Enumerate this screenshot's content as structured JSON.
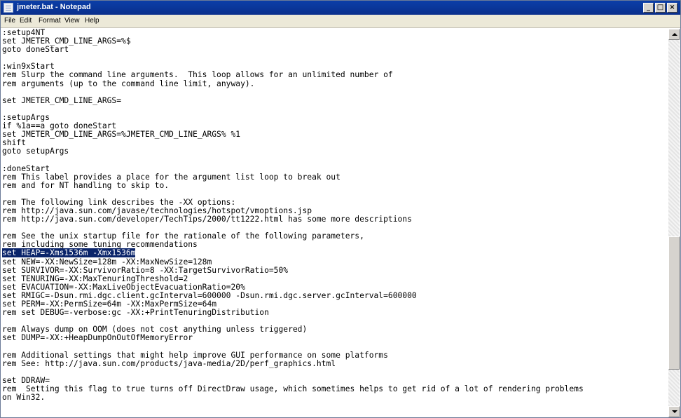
{
  "window": {
    "title": "jmeter.bat - Notepad"
  },
  "window_buttons": {
    "minimize": "_",
    "maximize": "□",
    "close": "×"
  },
  "menu": [
    "File",
    "Edit",
    "Format",
    "View",
    "Help"
  ],
  "editor": {
    "highlighted_line_index": 30,
    "lines": [
      ":setup4NT",
      "set JMETER_CMD_LINE_ARGS=%$",
      "goto doneStart",
      "",
      ":win9xStart",
      "rem Slurp the command line arguments.  This loop allows for an unlimited number of",
      "rem arguments (up to the command line limit, anyway).",
      "",
      "set JMETER_CMD_LINE_ARGS=",
      "",
      ":setupArgs",
      "if %1a==a goto doneStart",
      "set JMETER_CMD_LINE_ARGS=%JMETER_CMD_LINE_ARGS% %1",
      "shift",
      "goto setupArgs",
      "",
      ":doneStart",
      "rem This label provides a place for the argument list loop to break out",
      "rem and for NT handling to skip to.",
      "",
      "rem The following link describes the -XX options:",
      "rem http://java.sun.com/javase/technologies/hotspot/vmoptions.jsp",
      "rem http://java.sun.com/developer/TechTips/2000/tt1222.html has some more descriptions",
      "",
      "rem See the unix startup file for the rationale of the following parameters,",
      "rem including some tuning recommendations",
      "set HEAP=-Xms1536m -Xmx1536m",
      "set NEW=-XX:NewSize=128m -XX:MaxNewSize=128m",
      "set SURVIVOR=-XX:SurvivorRatio=8 -XX:TargetSurvivorRatio=50%",
      "set TENURING=-XX:MaxTenuringThreshold=2",
      "set EVACUATION=-XX:MaxLiveObjectEvacuationRatio=20%",
      "set RMIGC=-Dsun.rmi.dgc.client.gcInterval=600000 -Dsun.rmi.dgc.server.gcInterval=600000",
      "set PERM=-XX:PermSize=64m -XX:MaxPermSize=64m",
      "rem set DEBUG=-verbose:gc -XX:+PrintTenuringDistribution",
      "",
      "rem Always dump on OOM (does not cost anything unless triggered)",
      "set DUMP=-XX:+HeapDumpOnOutOfMemoryError",
      "",
      "rem Additional settings that might help improve GUI performance on some platforms",
      "rem See: http://java.sun.com/products/java-media/2D/perf_graphics.html",
      "",
      "set DDRAW=",
      "rem  Setting this flag to true turns off DirectDraw usage, which sometimes helps to get rid of a lot of rendering problems",
      "on Win32."
    ]
  }
}
